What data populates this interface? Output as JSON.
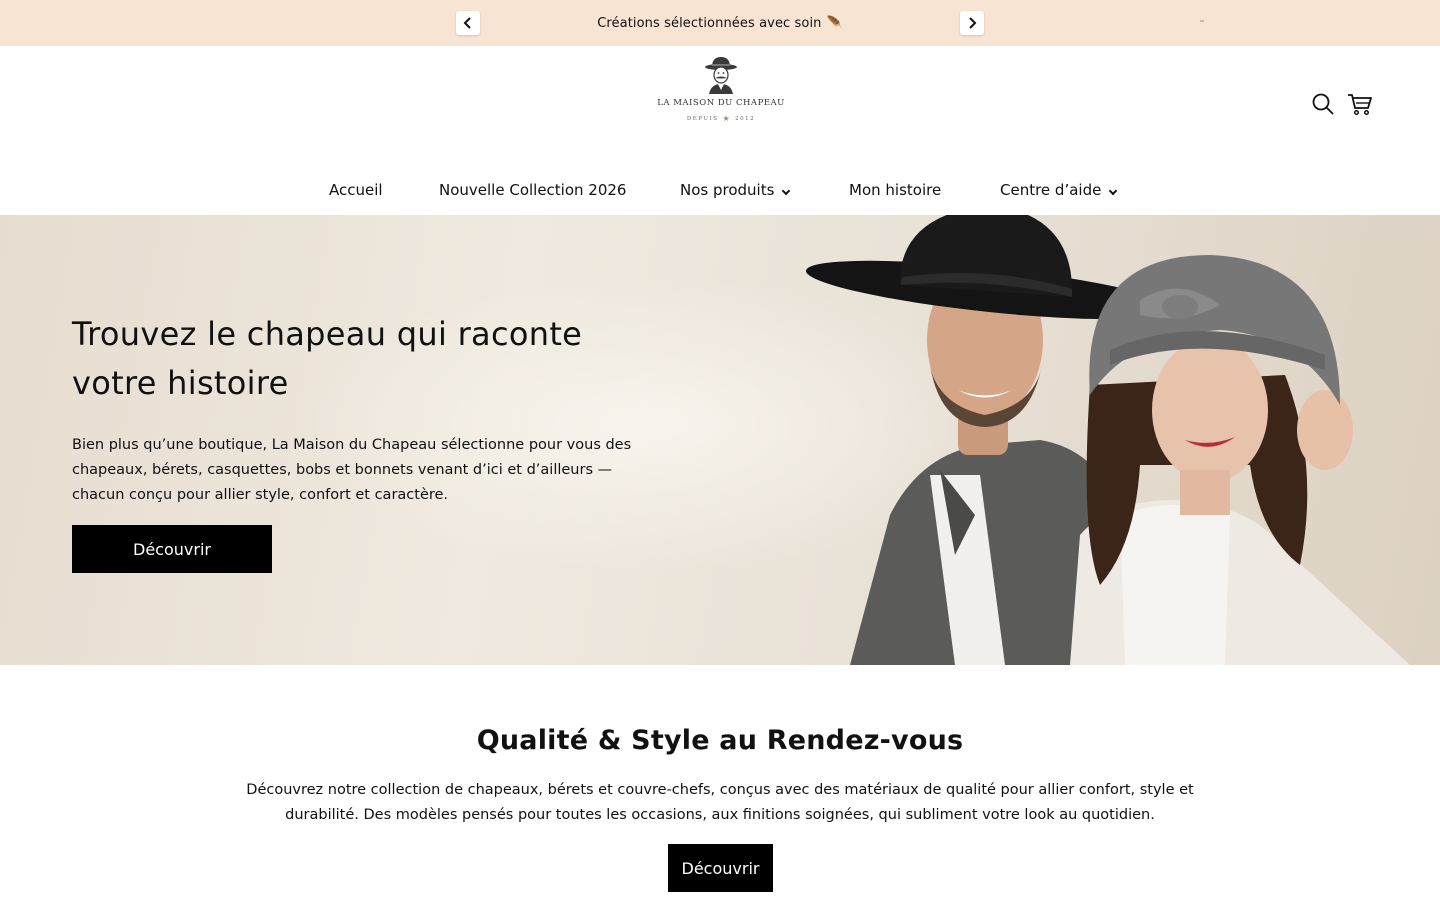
{
  "announcement": {
    "text": "Créations sélectionnées avec soin",
    "emoji": "🪶",
    "prev_icon": "chevron-left-icon",
    "next_icon": "chevron-right-icon"
  },
  "header": {
    "logo": {
      "name": "LA MAISON DU CHAPEAU",
      "since_left": "DEPUIS",
      "since_right": "2012"
    },
    "icons": [
      "search-icon",
      "cart-icon"
    ],
    "nav": [
      {
        "label": "Accueil",
        "dropdown": false
      },
      {
        "label": "Nouvelle Collection 2026",
        "dropdown": false
      },
      {
        "label": "Nos produits",
        "dropdown": true
      },
      {
        "label": "Mon histoire",
        "dropdown": false
      },
      {
        "label": "Centre d’aide",
        "dropdown": true
      }
    ]
  },
  "hero": {
    "title": "Trouvez le chapeau qui raconte votre histoire",
    "description": "Bien plus qu’une boutique, La Maison du Chapeau sélectionne pour vous des chapeaux, bérets, casquettes, bobs et bonnets venant d’ici et d’ailleurs — chacun conçu pour allier style, confort et caractère.",
    "button": "Découvrir"
  },
  "section": {
    "title": "Qualité & Style au Rendez-vous",
    "description": "Découvrez notre collection de chapeaux, bérets et couvre-chefs, conçus avec des matériaux de qualité pour allier confort, style et durabilité. Des modèles pensés pour toutes les occasions, aux finitions soignées, qui subliment votre look au quotidien.",
    "button": "Découvrir"
  },
  "colors": {
    "announcement_bg": "#f8e4d2",
    "button_bg": "#000000",
    "hero_bg": "#e9e2d7"
  }
}
